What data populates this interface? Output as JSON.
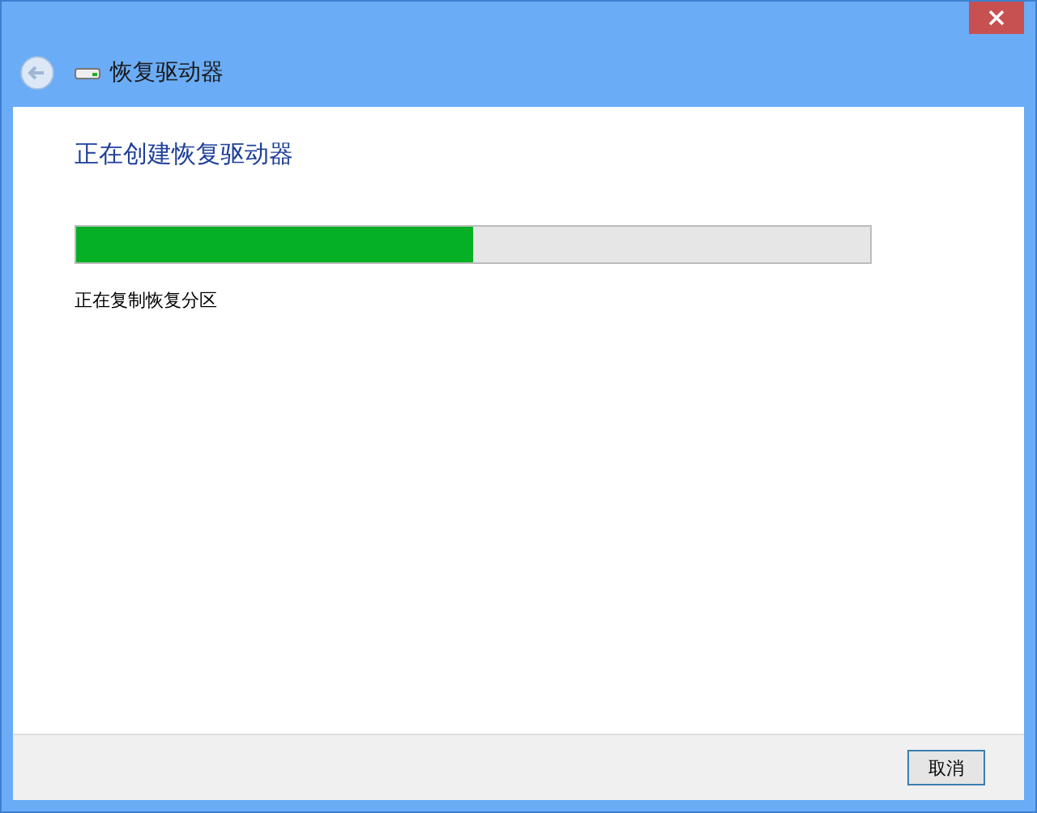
{
  "window": {
    "title": "恢复驱动器"
  },
  "heading": "正在创建恢复驱动器",
  "progress": {
    "level": 0.5
  },
  "status": "正在复制恢复分区",
  "buttons": [
    "取消"
  ]
}
